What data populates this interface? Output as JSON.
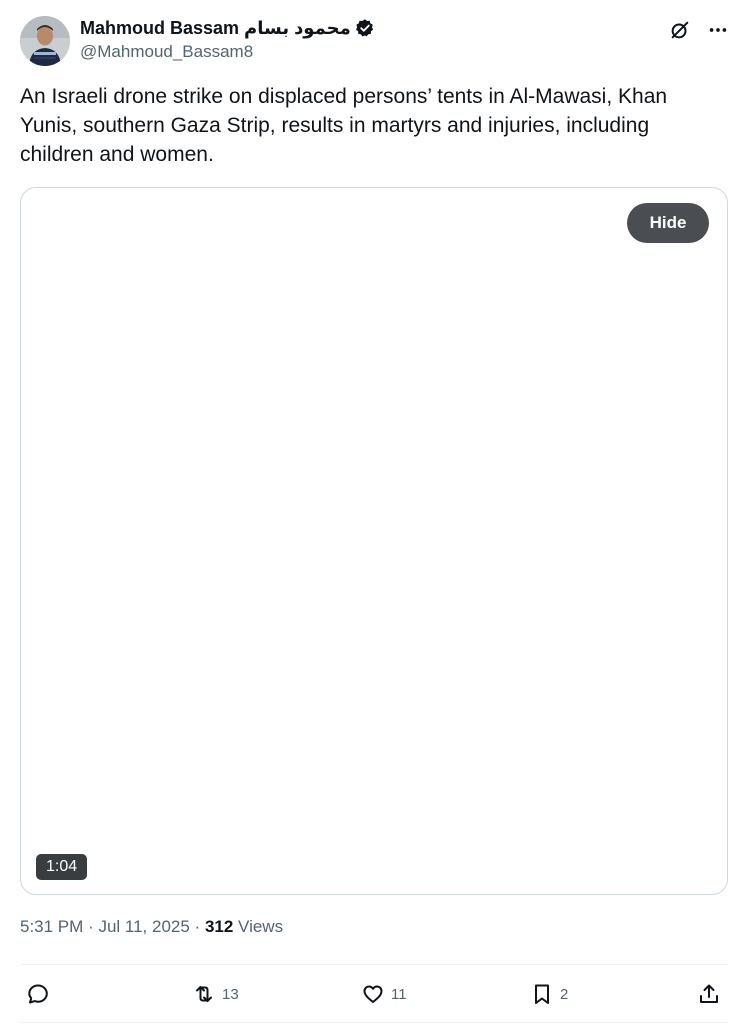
{
  "author": {
    "display_name": "Mahmoud Bassam محمود بسام",
    "handle": "@Mahmoud_Bassam8",
    "verified": true
  },
  "top_actions": {
    "grok_icon": "grok-icon",
    "more_icon": "more-icon"
  },
  "tweet": {
    "text": "An Israeli drone strike on displaced persons’ tents in Al-Mawasi, Khan Yunis, southern Gaza Strip, results in martyrs and injuries, including children and women."
  },
  "media": {
    "hide_label": "Hide",
    "duration": "1:04"
  },
  "meta": {
    "time": "5:31 PM",
    "date": "Jul 11, 2025",
    "views_count": "312",
    "views_label": "Views"
  },
  "actions": {
    "reply_count": "",
    "retweet_count": "13",
    "like_count": "11",
    "bookmark_count": "2"
  },
  "colors": {
    "text_primary": "#0f1419",
    "text_secondary": "#536471",
    "border": "#cfd9de",
    "hide_button_bg": "#4a4e52"
  }
}
